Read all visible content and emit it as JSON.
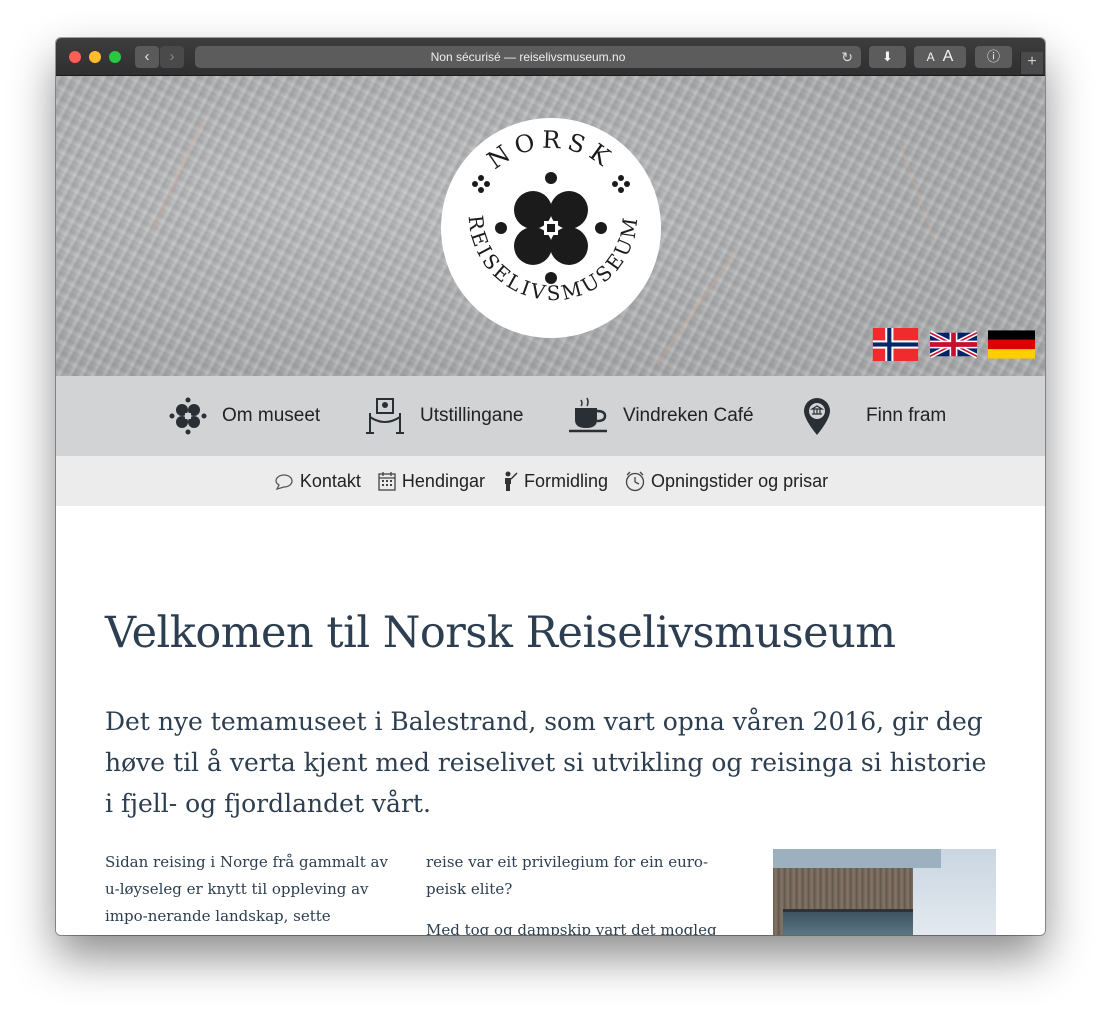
{
  "browser": {
    "address": "Non sécurisé — reiselivsmuseum.no",
    "back_glyph": "‹",
    "forward_glyph": "›",
    "reload_glyph": "↻",
    "download_glyph": "⬇",
    "font_small": "A",
    "font_large": "A",
    "info_glyph": "ⓘ",
    "new_tab_glyph": "+"
  },
  "logo": {
    "top_text": "NORSK",
    "ring_text": "REISELIVSMUSEUM"
  },
  "flags": [
    "norway-flag",
    "uk-flag",
    "germany-flag"
  ],
  "main_nav": [
    {
      "label": "Om museet",
      "icon": "clover-icon"
    },
    {
      "label": "Utstillingane",
      "icon": "exhibit-icon"
    },
    {
      "label": "Vindreken Café",
      "icon": "coffee-cup-icon"
    },
    {
      "label": "Finn fram",
      "icon": "map-pin-icon"
    }
  ],
  "sub_nav": [
    {
      "label": "Kontakt",
      "icon": "chat-icon"
    },
    {
      "label": "Hendingar",
      "icon": "calendar-icon"
    },
    {
      "label": "Formidling",
      "icon": "guide-icon"
    },
    {
      "label": "Opningstider og prisar",
      "icon": "clock-icon"
    }
  ],
  "content": {
    "title": "Velkomen til Norsk Reiselivsmuseum",
    "lead": "Det nye temamuseet i Balestrand, som vart opna våren 2016, gir deg høve til å verta kjent med reiselivet si utvikling og reisinga si historie i fjell- og fjordlandet vårt.",
    "col1": "Sidan reising i Norge frå gammalt av u-løyseleg er knytt til oppleving av impo-nerande landskap, sette arkitekten,",
    "col2": "reise var eit privilegium for ein euro-peisk elite?",
    "col2_b": "Med tog og dampskip vart det mogleg å rei-"
  },
  "colors": {
    "heading": "#2c3e50",
    "main_nav_bg": "#d2d3d5",
    "sub_nav_bg": "#ececec"
  }
}
